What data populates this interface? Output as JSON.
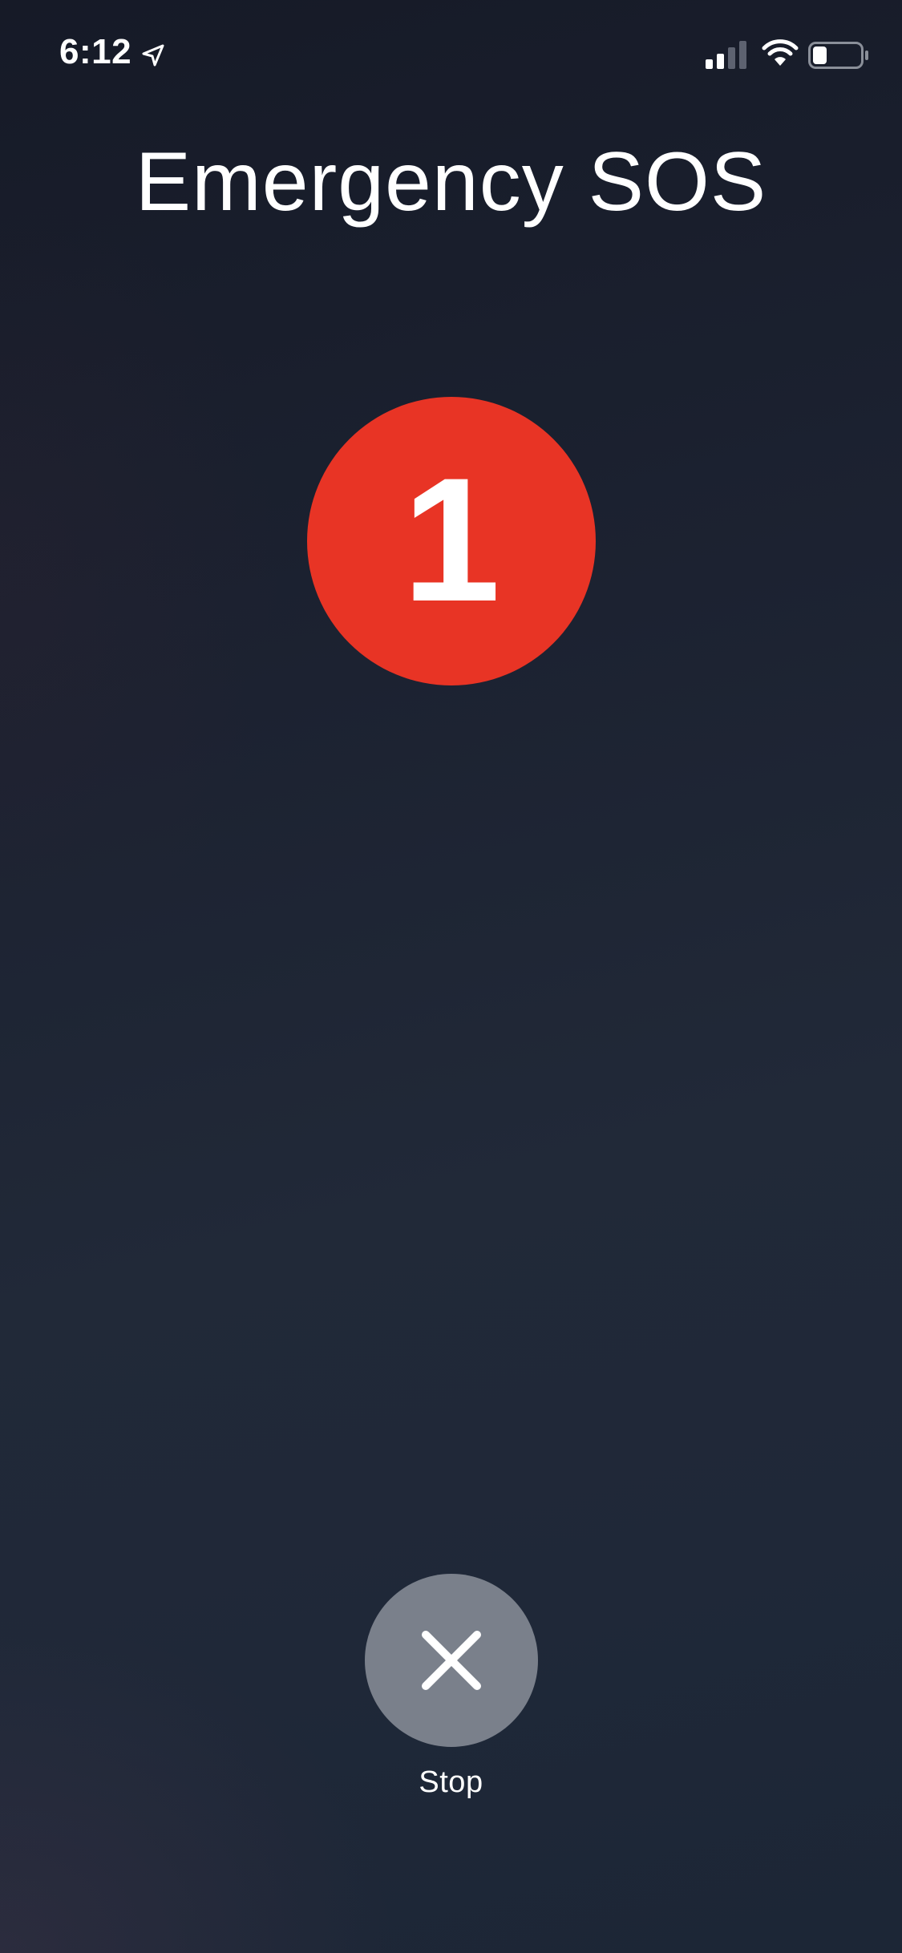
{
  "status_bar": {
    "time": "6:12",
    "location_icon": "location-arrow-icon",
    "signal_icon": "cellular-signal-icon",
    "signal_level": "2 of 4 bars",
    "wifi_icon": "wifi-icon",
    "battery_icon": "battery-icon",
    "battery_level": 0.3
  },
  "screen": {
    "title": "Emergency SOS",
    "countdown": "1",
    "countdown_color": "#e83425",
    "stop_label": "Stop",
    "stop_icon": "close-icon",
    "stop_button_color": "#7a808b"
  }
}
